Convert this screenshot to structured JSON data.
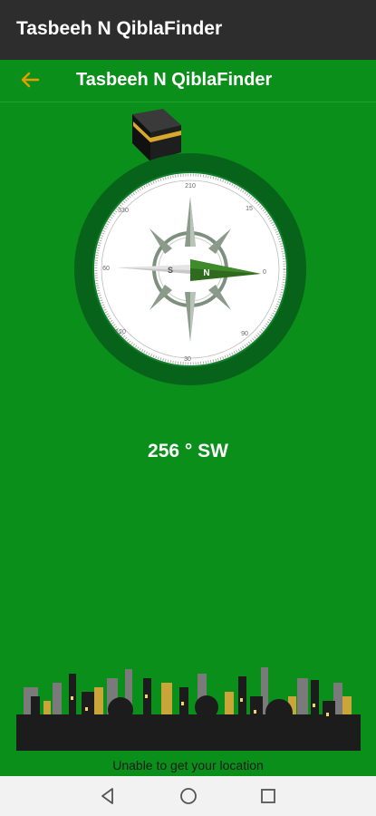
{
  "status_bar": {
    "title": "Tasbeeh N QiblaFinder"
  },
  "app_bar": {
    "back_icon": "arrow-left-icon",
    "title": "Tasbeeh N QiblaFinder"
  },
  "compass": {
    "kaaba_icon": "kaaba-icon",
    "tick_labels": [
      "210",
      "15",
      "30",
      "60",
      "90",
      "120",
      "150",
      "180",
      "0",
      "240",
      "270",
      "330"
    ],
    "needle_labels": {
      "south": "S",
      "north": "N"
    }
  },
  "heading": "256 ° SW",
  "location_message": "Unable to get your location",
  "nav": {
    "back": "triangle-back-icon",
    "home": "circle-home-icon",
    "recents": "square-recents-icon"
  },
  "colors": {
    "primary": "#0a8f1a",
    "dark_ring": "#07631a",
    "accent": "#e0a000",
    "status": "#2d2d2d"
  }
}
